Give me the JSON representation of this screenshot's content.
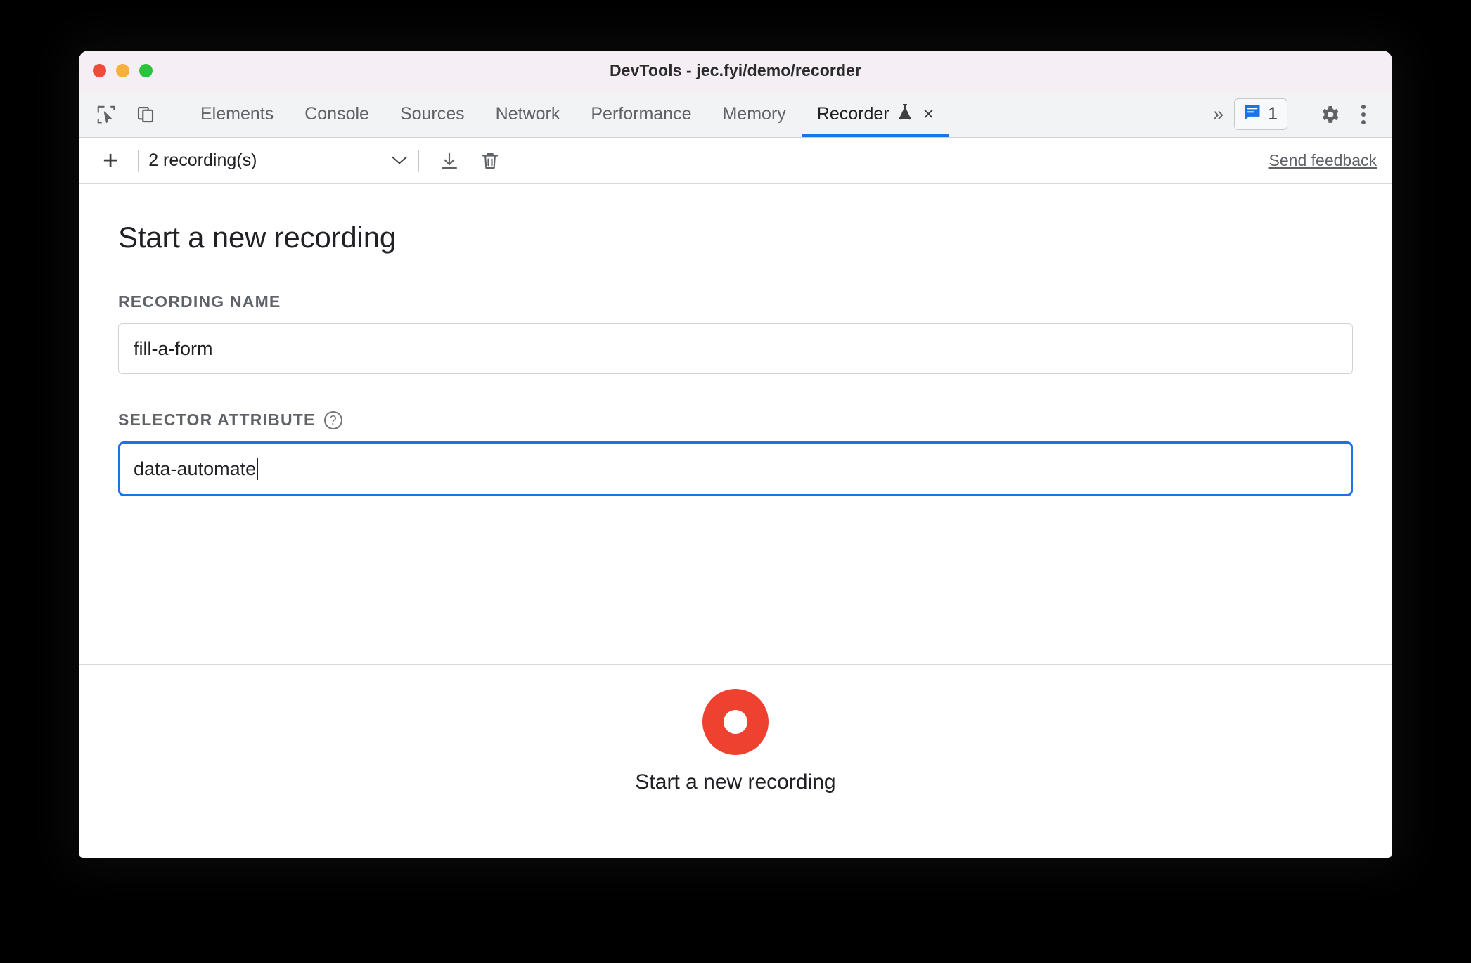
{
  "window": {
    "title": "DevTools - jec.fyi/demo/recorder",
    "traffic_lights": [
      "close",
      "minimize",
      "zoom"
    ],
    "colors": {
      "close": "#ee4b3a",
      "minimize": "#f5b03e",
      "zoom": "#2dc23c",
      "accent": "#1a73e8",
      "record": "#ee4130",
      "titlebar_bg": "#f5eff5",
      "tabbar_bg": "#f1f3f4"
    }
  },
  "tabbar": {
    "inspect_icon": "inspect-element-icon",
    "device_icon": "device-toolbar-icon",
    "tabs": [
      {
        "label": "Elements",
        "active": false
      },
      {
        "label": "Console",
        "active": false
      },
      {
        "label": "Sources",
        "active": false
      },
      {
        "label": "Network",
        "active": false
      },
      {
        "label": "Performance",
        "active": false
      },
      {
        "label": "Memory",
        "active": false
      },
      {
        "label": "Recorder",
        "active": true,
        "experiment_icon": "flask-icon",
        "close_label": "×"
      }
    ],
    "more_tabs_label": "»",
    "message_badge": {
      "icon": "console-message-icon",
      "count": "1"
    },
    "settings_icon": "gear-icon",
    "menu_icon": "three-dot-menu-icon"
  },
  "recorder_toolbar": {
    "add_label": "+",
    "recordings_select": "2 recording(s)",
    "chevron": "⌄",
    "import_icon": "download-icon",
    "delete_icon": "trash-icon",
    "feedback_label": "Send feedback"
  },
  "main": {
    "heading": "Start a new recording",
    "fields": [
      {
        "label": "RECORDING NAME",
        "value": "fill-a-form",
        "placeholder": "Enter recording name",
        "focused": false,
        "help": false
      },
      {
        "label": "SELECTOR ATTRIBUTE",
        "value": "data-automate",
        "placeholder": "Enter selector attribute",
        "focused": true,
        "help": true,
        "help_icon": "help-circle-icon"
      }
    ]
  },
  "footer": {
    "record_icon": "record-circle-icon",
    "record_label": "Start a new recording"
  }
}
